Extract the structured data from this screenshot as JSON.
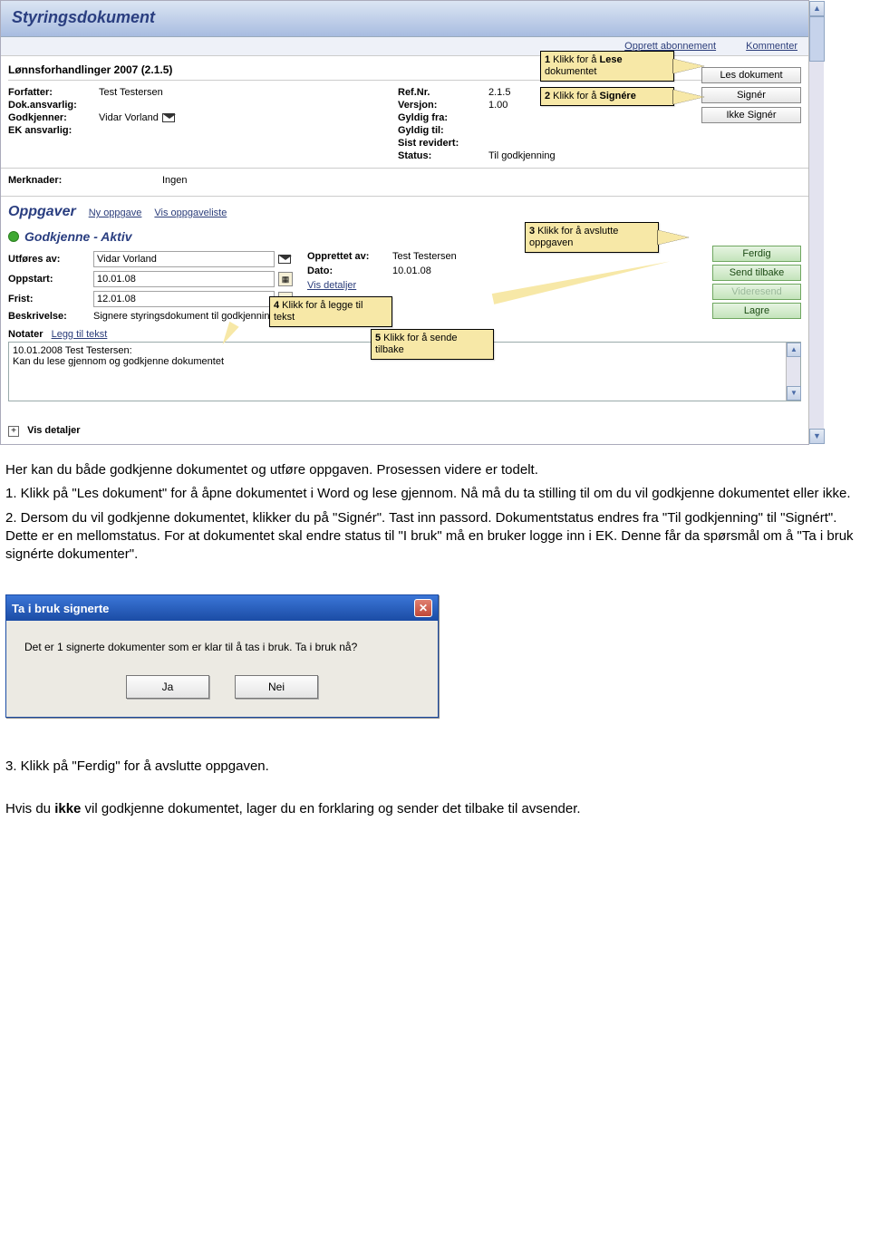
{
  "app": {
    "title": "Styringsdokument",
    "links": {
      "subscribe": "Opprett abonnement",
      "comment": "Kommenter"
    },
    "doc_title": "Lønnsforhandlinger 2007 (2.1.5)",
    "meta_left": {
      "author_lbl": "Forfatter:",
      "author": "Test Testersen",
      "resp_lbl": "Dok.ansvarlig:",
      "resp": "",
      "approver_lbl": "Godkjenner:",
      "approver": "Vidar Vorland",
      "ek_lbl": "EK ansvarlig:",
      "ek": ""
    },
    "meta_mid": {
      "ref_lbl": "Ref.Nr.",
      "ref": "2.1.5",
      "ver_lbl": "Versjon:",
      "ver": "1.00",
      "from_lbl": "Gyldig fra:",
      "from": "",
      "to_lbl": "Gyldig til:",
      "to": "",
      "rev_lbl": "Sist revidert:",
      "rev": "",
      "status_lbl": "Status:",
      "status": "Til godkjenning"
    },
    "doc_buttons": {
      "read": "Les dokument",
      "sign": "Signér",
      "nosign": "Ikke Signér"
    },
    "merknader_lbl": "Merknader:",
    "merknader": "Ingen",
    "tasks": {
      "title": "Oppgaver",
      "new": "Ny oppgave",
      "list": "Vis oppgaveliste",
      "task_name": "Godkjenne  - Aktiv",
      "fields": {
        "by_lbl": "Utføres av:",
        "by": "Vidar Vorland",
        "start_lbl": "Oppstart:",
        "start": "10.01.08",
        "due_lbl": "Frist:",
        "due": "12.01.08",
        "desc_lbl": "Beskrivelse:",
        "desc": "Signere styringsdokument til godkjenning",
        "created_by_lbl": "Opprettet av:",
        "created_by": "Test Testersen",
        "date_lbl": "Dato:",
        "date": "10.01.08",
        "details": "Vis detaljer"
      },
      "buttons": {
        "done": "Ferdig",
        "back": "Send tilbake",
        "forward": "Videresend",
        "save": "Lagre"
      },
      "notes_lbl": "Notater",
      "notes_add": "Legg til tekst",
      "note_line1": "10.01.2008 Test Testersen:",
      "note_line2": "Kan du lese gjennom og godkjenne dokumentet"
    },
    "expand": "Vis detaljer"
  },
  "callouts": {
    "c1a": "Klikk for å",
    "c1b": "Lese",
    "c1c": "dokumentet",
    "c2a": "Klikk for å",
    "c2b": "Signére",
    "c3": "Klikk for å avslutte oppgaven",
    "c4": "Klikk for å legge til tekst",
    "c5": "Klikk for å sende tilbake"
  },
  "body": {
    "p1": "Her kan du både godkjenne dokumentet og utføre oppgaven. Prosessen videre er todelt.",
    "p2": "1. Klikk på \"Les dokument\" for å åpne dokumentet i Word og lese gjennom. Nå må du ta stilling til om du vil godkjenne dokumentet eller ikke.",
    "p3": "2. Dersom du vil godkjenne dokumentet, klikker du på \"Signér\". Tast inn passord. Dokumentstatus endres fra \"Til godkjenning\" til \"Signért\". Dette er en mellomstatus. For at dokumentet skal endre status til \"I bruk\" må en bruker logge inn i EK. Denne får da spørsmål om å \"Ta i bruk signérte dokumenter\".",
    "p4": "3. Klikk på \"Ferdig\" for å avslutte oppgaven.",
    "p5a": "Hvis du ",
    "p5b": "ikke",
    "p5c": " vil godkjenne dokumentet, lager du en forklaring og sender det tilbake til avsender."
  },
  "dialog": {
    "title": "Ta i bruk signerte",
    "msg": "Det er 1 signerte dokumenter som er klar til å tas i bruk. Ta i bruk nå?",
    "yes": "Ja",
    "no": "Nei"
  }
}
